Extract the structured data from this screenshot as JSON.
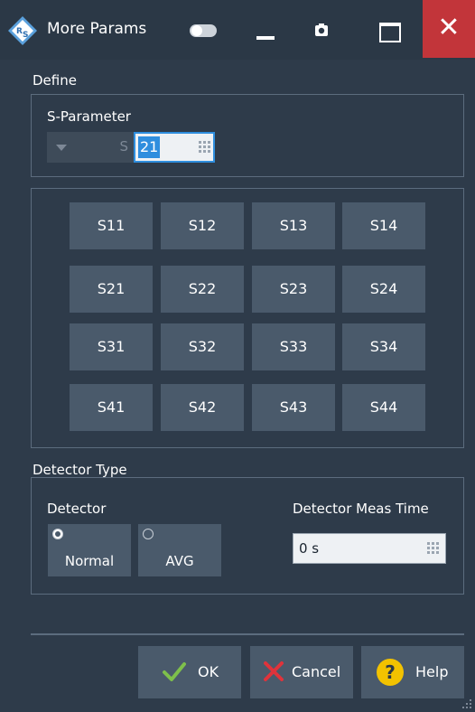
{
  "window": {
    "title": "More Params",
    "close_glyph": "✕",
    "icons": [
      "toggle-icon",
      "minimize-icon",
      "camera-icon",
      "maximize-icon",
      "close-icon"
    ]
  },
  "define": {
    "group_label": "Define",
    "sparam_label": "S-Parameter",
    "combo_prefix": "S",
    "sparam_value": "21"
  },
  "matrix": {
    "rows": [
      [
        "S11",
        "S12",
        "S13",
        "S14"
      ],
      [
        "S21",
        "S22",
        "S23",
        "S24"
      ],
      [
        "S31",
        "S32",
        "S33",
        "S34"
      ],
      [
        "S41",
        "S42",
        "S43",
        "S44"
      ]
    ]
  },
  "detector": {
    "group_label": "Detector Type",
    "detector_label": "Detector",
    "options": [
      {
        "label": "Normal",
        "selected": true
      },
      {
        "label": "AVG",
        "selected": false
      }
    ],
    "meas_time_label": "Detector Meas Time",
    "meas_time_value": "0 s"
  },
  "footer": {
    "ok_label": "OK",
    "cancel_label": "Cancel",
    "help_label": "Help"
  },
  "colors": {
    "background": "#2e3b4a",
    "button": "#4a5a6b",
    "close": "#c2353a",
    "accent": "#2f8ede",
    "ok_check": "#7ec04b",
    "cancel_x": "#e0333b",
    "help_circle": "#f2c200"
  }
}
